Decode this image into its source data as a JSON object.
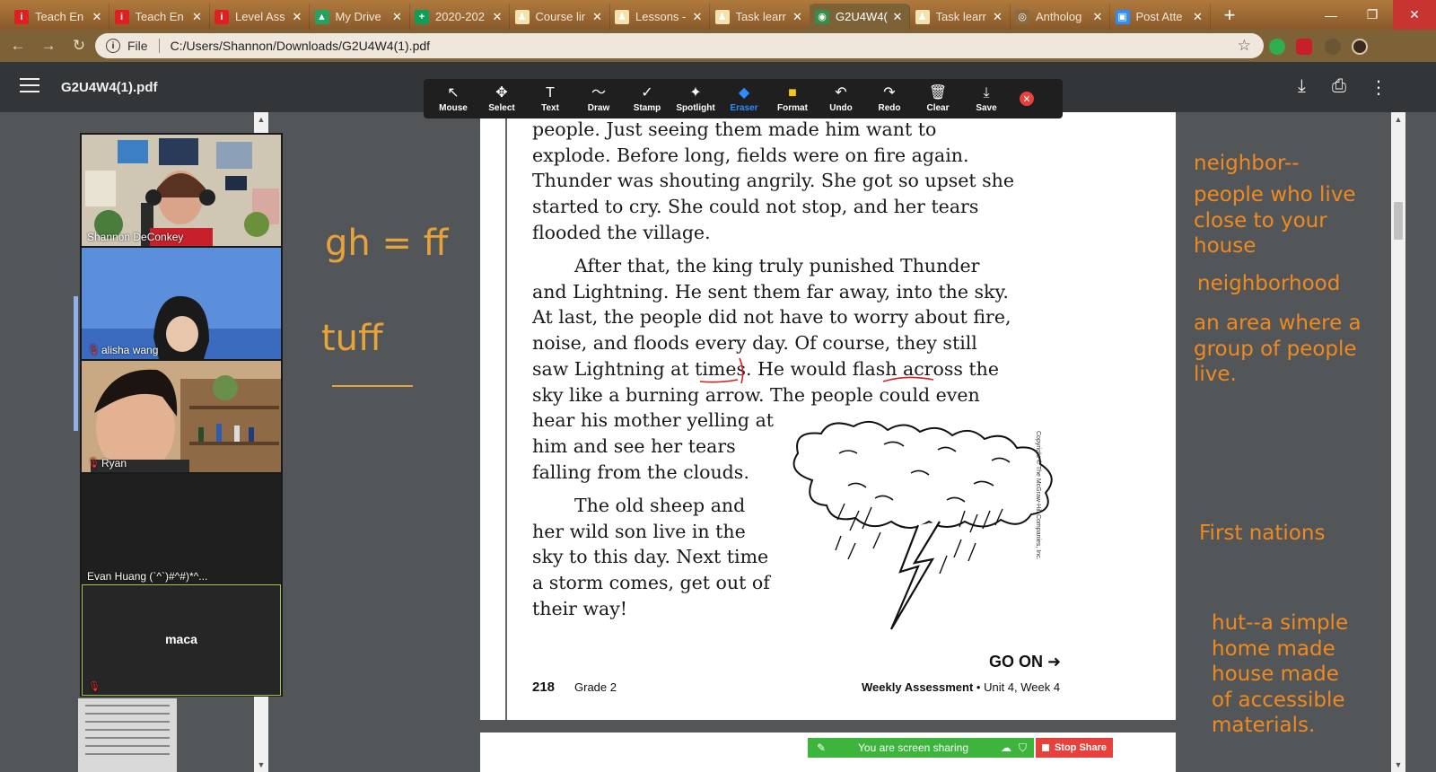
{
  "browser": {
    "tabs": [
      {
        "title": "Teach En",
        "icon": "i",
        "icon_color": "#e02020"
      },
      {
        "title": "Teach En",
        "icon": "i",
        "icon_color": "#e02020"
      },
      {
        "title": "Level Ass",
        "icon": "i",
        "icon_color": "#e02020"
      },
      {
        "title": "My Drive",
        "icon": "▲",
        "icon_color": "#1fa463"
      },
      {
        "title": "2020-202",
        "icon": "+",
        "icon_color": "#0f9d58"
      },
      {
        "title": "Course lir",
        "icon": "♟",
        "icon_color": "#f3e1b0"
      },
      {
        "title": "Lessons -",
        "icon": "♟",
        "icon_color": "#f3e1b0"
      },
      {
        "title": "Task learr",
        "icon": "♟",
        "icon_color": "#f3e1b0"
      },
      {
        "title": "G2U4W4(",
        "icon": "◉",
        "icon_color": "#3a8c4a"
      },
      {
        "title": "Task learr",
        "icon": "♟",
        "icon_color": "#f3e1b0"
      },
      {
        "title": "Antholog",
        "icon": "◎",
        "icon_color": "#8a6a40"
      },
      {
        "title": "Post Atte",
        "icon": "▣",
        "icon_color": "#2d8cff"
      }
    ],
    "active_tab_index": 8,
    "address": {
      "scheme": "File",
      "path": "C:/Users/Shannon/Downloads/G2U4W4(1).pdf"
    }
  },
  "pdf_viewer": {
    "filename": "G2U4W4(1).pdf"
  },
  "annotation_toolbar": {
    "tools": [
      {
        "label": "Mouse",
        "icon": "↖"
      },
      {
        "label": "Select",
        "icon": "✥"
      },
      {
        "label": "Text",
        "icon": "T"
      },
      {
        "label": "Draw",
        "icon": "〜"
      },
      {
        "label": "Stamp",
        "icon": "✓"
      },
      {
        "label": "Spotlight",
        "icon": "✦"
      },
      {
        "label": "Eraser",
        "icon": "◆"
      },
      {
        "label": "Format",
        "icon": "■"
      },
      {
        "label": "Undo",
        "icon": "↶"
      },
      {
        "label": "Redo",
        "icon": "↷"
      },
      {
        "label": "Clear",
        "icon": "🗑"
      },
      {
        "label": "Save",
        "icon": "⤓"
      }
    ],
    "active_tool": "Eraser"
  },
  "participants": [
    {
      "name": "Shannon DeConkey",
      "muted": false
    },
    {
      "name": "alisha wang",
      "muted": true
    },
    {
      "name": "Ryan",
      "muted": true
    },
    {
      "name": "Evan Huang (`^`)#^#)*^...",
      "muted": false
    },
    {
      "name": "maca",
      "muted": true
    }
  ],
  "whiteboard": {
    "line1": "gh = ff",
    "line2": "tuff"
  },
  "page": {
    "paragraph1": [
      "people. Just seeing them made him want to",
      "explode. Before long, fields were on fire again.",
      "Thunder was shouting angrily. She got so upset she",
      "started to cry. She could not stop, and her tears",
      "flooded the village."
    ],
    "paragraph2": [
      "After that, the king truly punished Thunder",
      "and Lightning. He sent them far away, into the sky.",
      "At last, the people did not have to worry about fire,",
      "noise, and floods every day. Of course, they still",
      "saw Lightning at times. He would flash across the",
      "sky like a burning arrow. The people could even",
      "hear his mother yelling at",
      "him and see her tears",
      "falling from the clouds."
    ],
    "paragraph3": [
      "The old sheep and",
      "her wild son live in the",
      "sky to this day. Next time",
      "a storm comes, get out of",
      "their way!"
    ],
    "copyright": "Copyright © The McGraw-Hill Companies, Inc.",
    "go_on": "GO ON ➜",
    "page_number": "218",
    "grade": "Grade 2",
    "assessment_bold": "Weekly Assessment",
    "assessment_rest": " • Unit 4, Week 4"
  },
  "notes": {
    "n1": "neighbor--",
    "n2": [
      "people who live",
      "close to your",
      "house"
    ],
    "n3": "neighborhood",
    "n4": [
      "an area where a",
      "group of people",
      "live."
    ],
    "n5": "First nations",
    "n6": [
      "hut--a simple",
      "home made",
      "house made",
      "of accessible",
      "materials."
    ]
  },
  "screen_share": {
    "status": "You are screen sharing",
    "stop_label": "Stop Share"
  }
}
